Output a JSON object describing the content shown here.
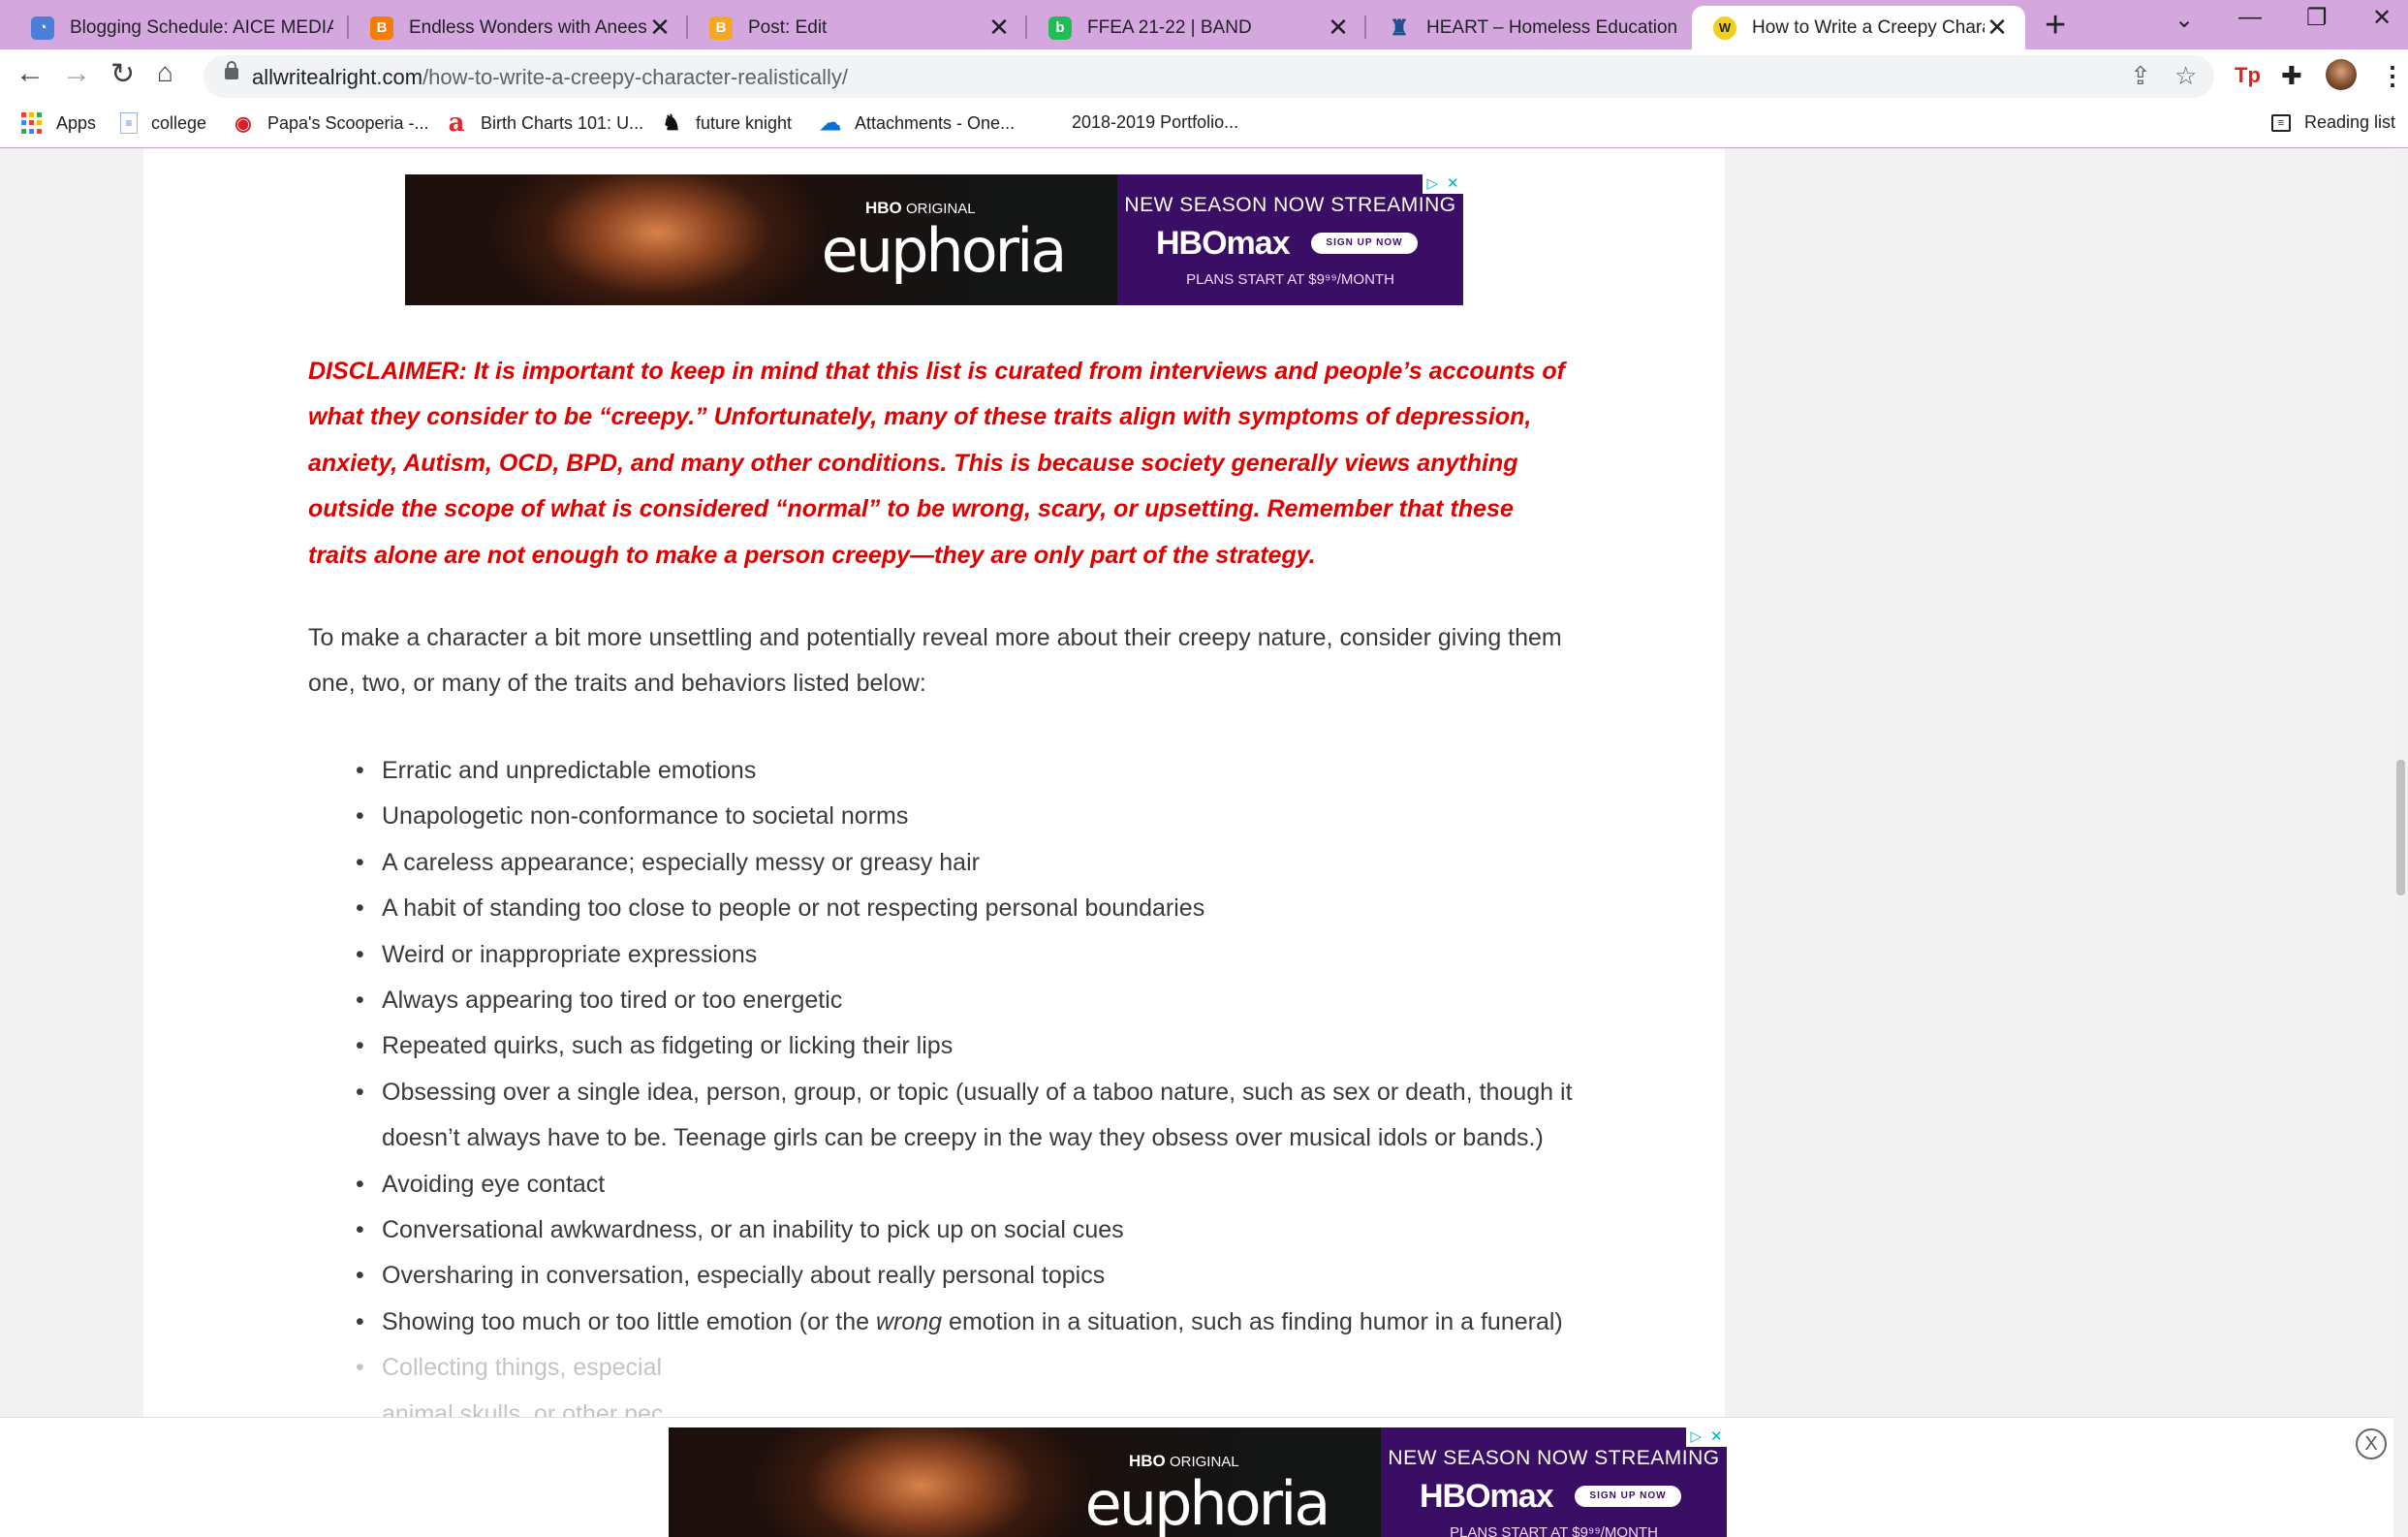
{
  "browser": {
    "tabs": [
      {
        "title": "Blogging Schedule: AICE MEDIA",
        "favicon": "docs-icon",
        "color": "#4a7fd9"
      },
      {
        "title": "Endless Wonders with Aneesa",
        "favicon": "blogger-icon",
        "color": "#f57d00"
      },
      {
        "title": "Post: Edit",
        "favicon": "blogger-icon",
        "color": "#f5a623"
      },
      {
        "title": "FFEA 21-22 | BAND",
        "favicon": "band-icon",
        "color": "#1fbd53"
      },
      {
        "title": "HEART – Homeless Education A",
        "favicon": "heart-org-icon",
        "color": "#1f4e8c"
      },
      {
        "title": "How to Write a Creepy Characte",
        "favicon": "site-logo-icon",
        "color": "#f2d01a",
        "active": true
      }
    ],
    "new_tab": "+",
    "window_controls": {
      "tab_search": "⌄",
      "minimize": "—",
      "restore": "❐",
      "close": "✕"
    },
    "url_host": "allwritealright.com",
    "url_path": "/how-to-write-a-creepy-character-realistically/",
    "bookmarks": [
      {
        "label": "Apps",
        "icon": "apps-grid-icon"
      },
      {
        "label": "college",
        "icon": "doc-icon"
      },
      {
        "label": "Papa's Scooperia -...",
        "icon": "papas-icon"
      },
      {
        "label": "Birth Charts 101: U...",
        "icon": "a-icon"
      },
      {
        "label": "future knight",
        "icon": "knight-icon"
      },
      {
        "label": "Attachments - One...",
        "icon": "onedrive-icon"
      },
      {
        "label": "2018-2019 Portfolio...",
        "icon": ""
      }
    ],
    "reading_list": "Reading list"
  },
  "ad": {
    "brand_small": "HBO",
    "brand_small_suffix": "ORIGINAL",
    "show": "euphoria",
    "headline": "NEW SEASON NOW STREAMING",
    "logo": "HBOmax",
    "cta": "SIGN UP NOW",
    "price": "PLANS START AT $9⁹⁹/MONTH",
    "adchoice_play": "▷",
    "adchoice_close": "✕"
  },
  "article": {
    "disclaimer": "DISCLAIMER: It is important to keep in mind that this list is curated from interviews and people’s accounts of what they consider to be “creepy.” Unfortunately, many of these traits align with symptoms of depression, anxiety, Autism, OCD, BPD, and many other conditions. This is because society generally views anything outside the scope of what is considered “normal” to be wrong, scary, or upsetting. Remember that these traits alone are not enough to make a person creepy—they are only part of the strategy.",
    "intro": "To make a character a bit more unsettling and potentially reveal more about their creepy nature, consider giving them one, two, or many of the traits and behaviors listed below:",
    "traits": [
      "Erratic and unpredictable emotions",
      "Unapologetic non-conformance to societal norms",
      "A careless appearance; especially messy or greasy hair",
      "A habit of standing too close to people or not respecting personal boundaries",
      "Weird or inappropriate expressions",
      "Always appearing too tired or too energetic",
      "Repeated quirks, such as fidgeting or licking their lips",
      "Obsessing over a single idea, person, group, or topic (usually of a taboo nature, such as sex or death, though it doesn’t always have to be. Teenage girls can be creepy in the way they obsess over musical idols or bands.)",
      "Avoiding eye contact",
      "Conversational awkwardness, or an inability to pick up on social cues",
      "Oversharing in conversation, especially about really personal topics"
    ],
    "trait_emotion_before": "Showing too much or too little emotion (or the ",
    "trait_emotion_em": "wrong",
    "trait_emotion_after": " emotion in a situation, such as finding humor in a funeral)",
    "trait_partial": "Collecting things, especial",
    "trait_partial_2": "animal skulls, or other pec"
  },
  "sticky_close": "X"
}
